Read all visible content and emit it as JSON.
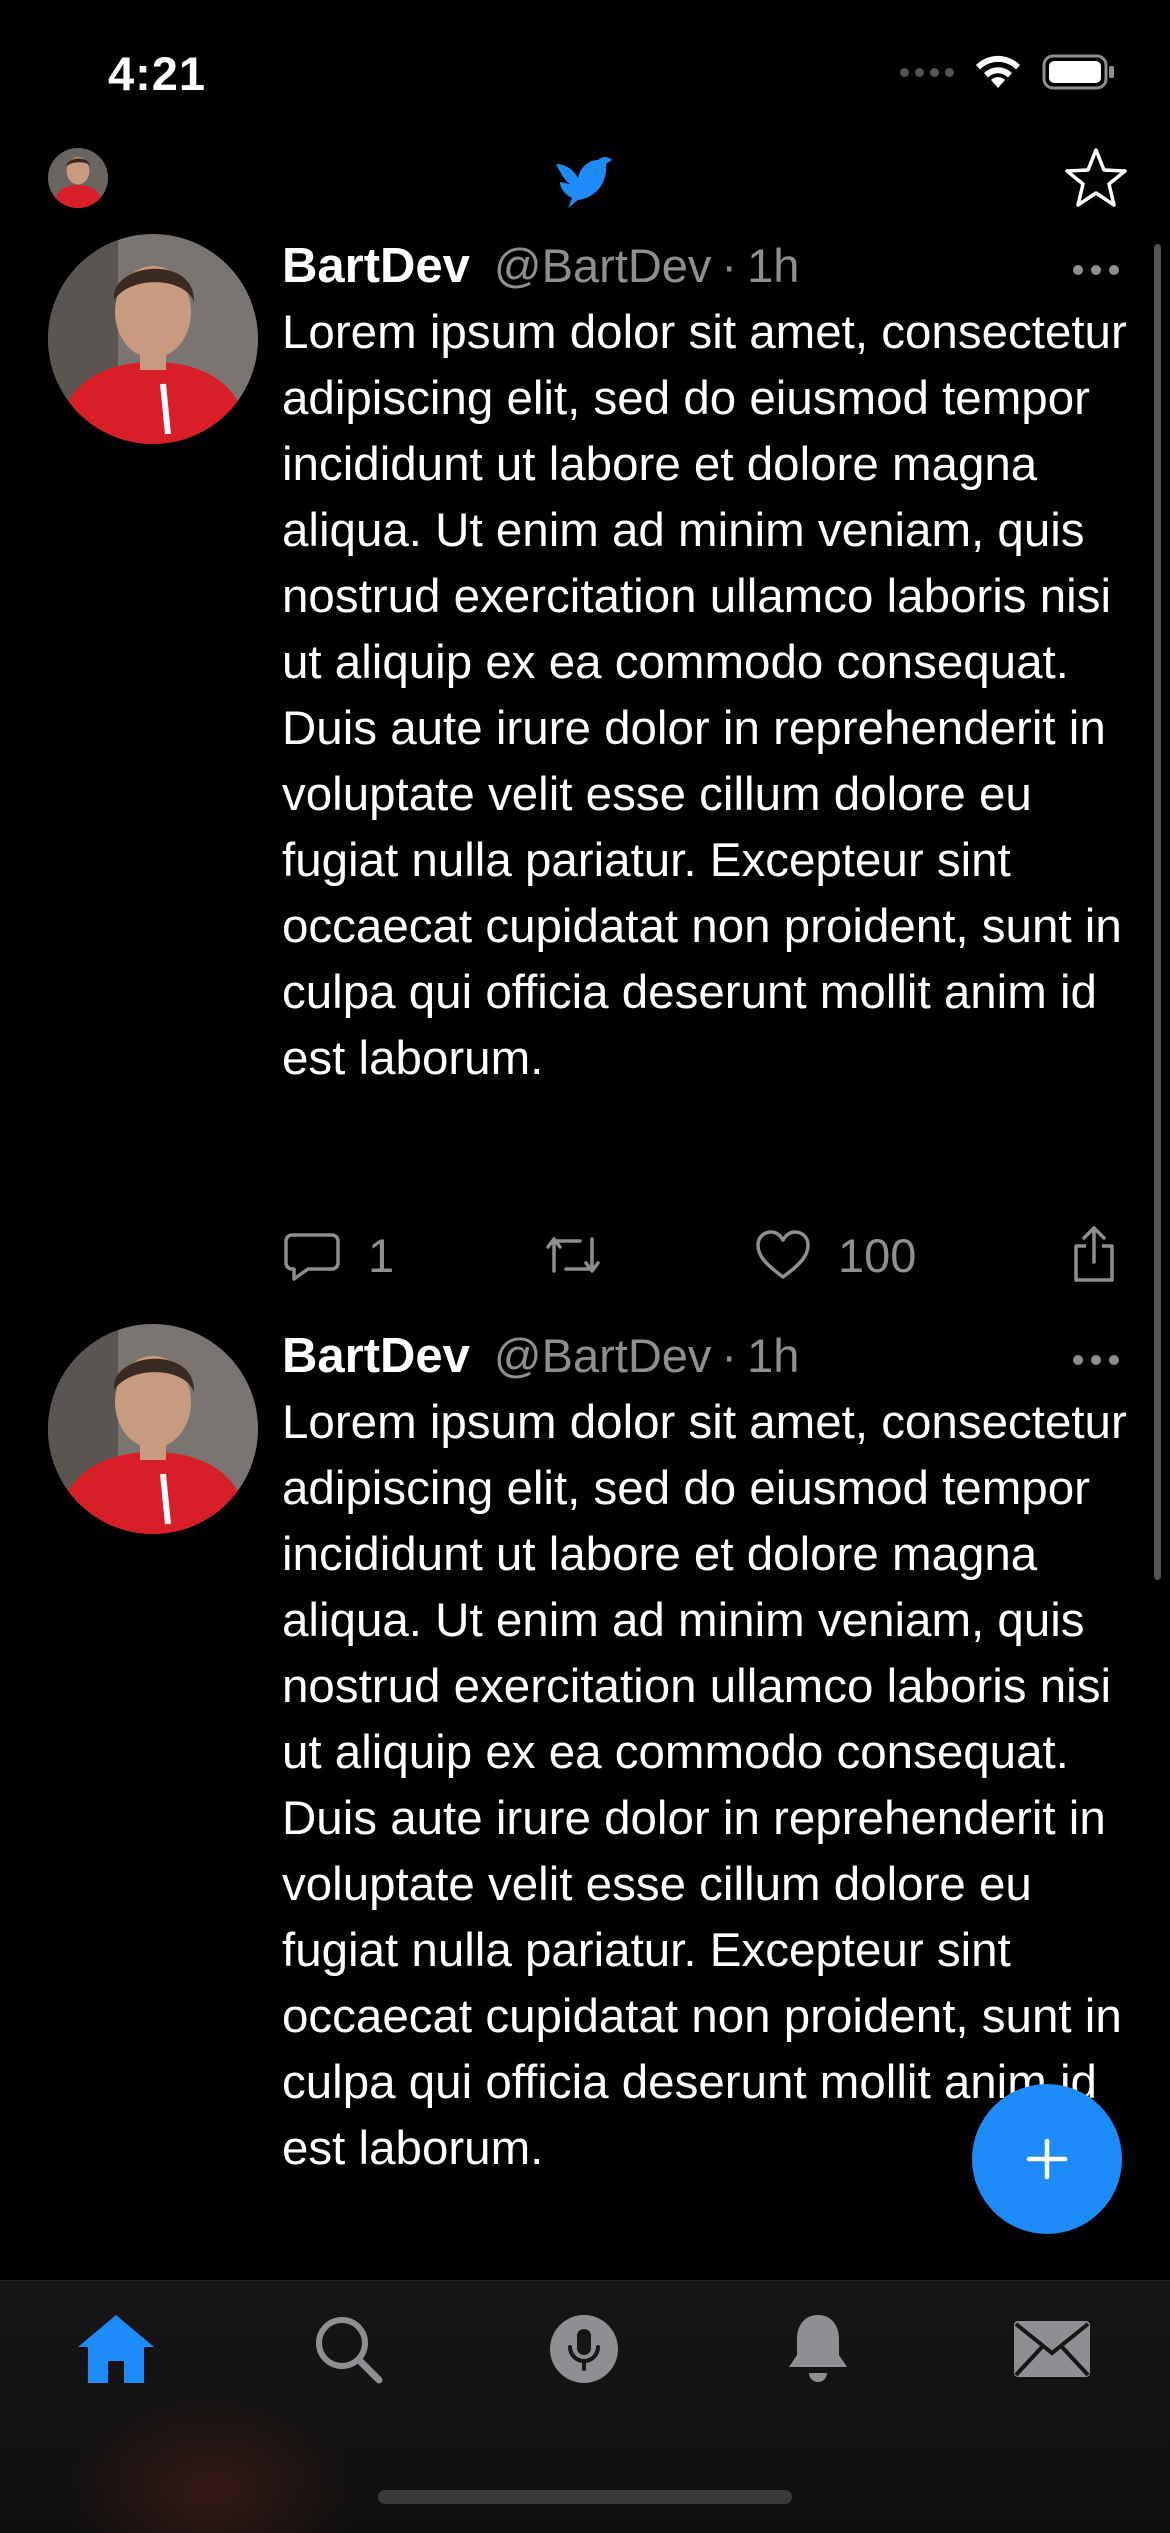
{
  "status_bar": {
    "time": "4:21",
    "icons": [
      "cellular-icon",
      "wifi-icon",
      "battery-icon"
    ]
  },
  "top_nav": {
    "logo": "bird-logo-icon",
    "right_icon": "star-icon"
  },
  "colors": {
    "accent": "#1d8cf8",
    "secondary_text": "#8e8e93",
    "background": "#000000"
  },
  "tweets": [
    {
      "name": "BartDev",
      "handle": "@BartDev",
      "separator": "·",
      "time": "1h",
      "text": "Lorem ipsum dolor sit amet, consectetur adipiscing elit, sed do eiusmod tempor incididunt ut labore et dolore magna aliqua. Ut enim ad minim veniam, quis nostrud exercitation ullamco laboris nisi ut aliquip ex ea commodo consequat. Duis aute irure dolor in reprehenderit in voluptate velit esse cillum dolore eu fugiat nulla pariatur. Excepteur sint occaecat cupidatat non proident, sunt in culpa qui officia deserunt mollit anim id est laborum.",
      "replies": "1",
      "likes": "100"
    },
    {
      "name": "BartDev",
      "handle": "@BartDev",
      "separator": "·",
      "time": "1h",
      "text": "Lorem ipsum dolor sit amet, consectetur adipiscing elit, sed do eiusmod tempor incididunt ut labore et dolore magna aliqua. Ut enim ad minim veniam, quis nostrud exercitation ullamco laboris nisi ut aliquip ex ea commodo consequat. Duis aute irure dolor in reprehenderit in voluptate velit esse cillum dolore eu fugiat nulla pariatur. Excepteur sint occaecat cupidatat non proident, sunt in culpa qui officia deserunt mollit anim id est laborum."
    }
  ],
  "tab_bar": {
    "items": [
      "home-icon",
      "search-icon",
      "spaces-mic-icon",
      "bell-icon",
      "mail-icon"
    ],
    "active": "home-icon"
  }
}
